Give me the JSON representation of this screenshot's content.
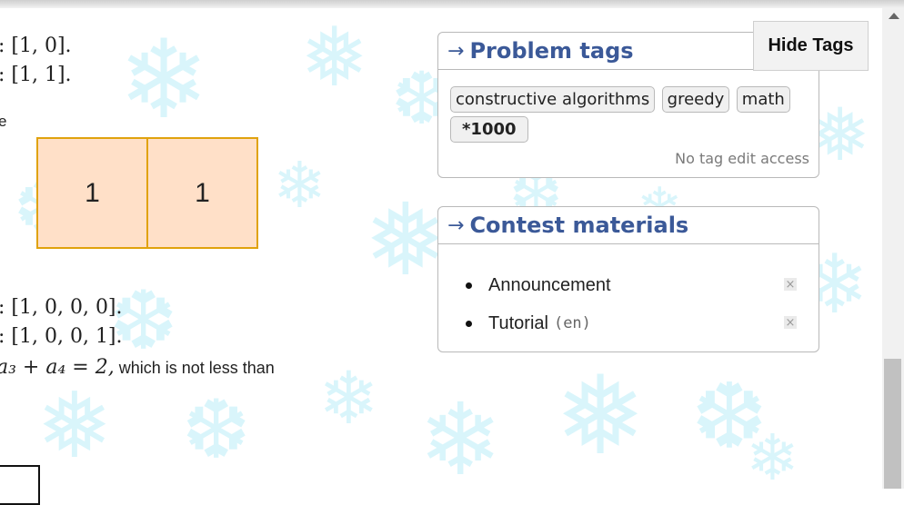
{
  "left_content": {
    "line1": ": [1, 0].",
    "line2": ": [1, 1].",
    "fragment_e": "e",
    "grid_cells": [
      "1",
      "1"
    ],
    "line3": ": [1, 0, 0, 0].",
    "line4": ": [1, 0, 0, 1].",
    "line5_math": "a₃ + a₄ = 2,",
    "line5_text": " which is not less than"
  },
  "problem_tags": {
    "arrow": "→",
    "title": "Problem tags",
    "tags": [
      "constructive algorithms",
      "greedy",
      "math"
    ],
    "rating": "*1000",
    "no_edit_access": "No tag edit access",
    "hide_button": "Hide Tags"
  },
  "contest_materials": {
    "arrow": "→",
    "title": "Contest materials",
    "items": [
      {
        "label": "Announcement",
        "lang": ""
      },
      {
        "label": "Tutorial",
        "lang": "(en)"
      }
    ],
    "remove_icon": "×"
  },
  "scrollbar": {
    "arrow_icon": "up-arrow-icon"
  }
}
